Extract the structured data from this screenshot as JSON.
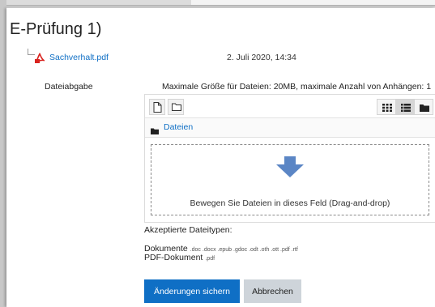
{
  "heading": {
    "title": "E-Prüfung 1)"
  },
  "attachment": {
    "file_name": "Sachverhalt.pdf",
    "date": "2. Juli 2020, 14:34",
    "icon": "pdf-file-icon"
  },
  "submission": {
    "label": "Dateiabgabe",
    "limits": "Maximale Größe für Dateien: 20MB, maximale Anzahl von Anhängen: 1"
  },
  "filepicker": {
    "toolbar_icons": [
      "add-file-icon",
      "create-folder-icon"
    ],
    "view_icons": [
      "icon-view-icon",
      "list-view-icon",
      "tree-view-icon"
    ],
    "active_view": "list",
    "path_label": "Dateien",
    "drop_hint": "Bewegen Sie Dateien in dieses Feld (Drag-and-drop)",
    "drop_arrow_color": "#5b86c5"
  },
  "accepted": {
    "heading": "Akzeptierte Dateitypen:",
    "types": [
      {
        "name": "Dokumente",
        "extensions": ".doc .docx .epub .gdoc .odt .oth .ott .pdf .rtf"
      },
      {
        "name": "PDF-Dokument",
        "extensions": ".pdf"
      }
    ]
  },
  "actions": {
    "save_label": "Änderungen sichern",
    "cancel_label": "Abbrechen"
  },
  "colors": {
    "link": "#0f6fc5",
    "primary_button": "#0f6fc5",
    "secondary_button": "#ced4da",
    "pdf_red": "#d9231f"
  }
}
